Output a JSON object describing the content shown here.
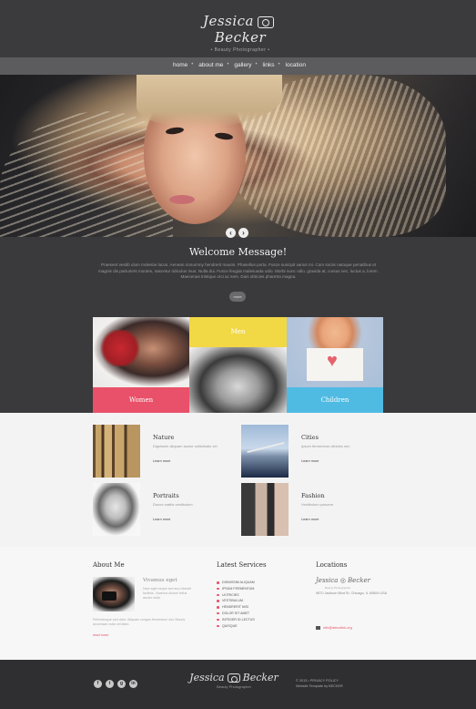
{
  "brand": {
    "name_left": "Jessica",
    "name_right": "Becker",
    "tagline": "Beauty Photographer"
  },
  "nav": {
    "items": [
      "home",
      "about me",
      "gallery",
      "links",
      "location"
    ]
  },
  "slider": {
    "prev_icon": "chevron-left-icon",
    "next_icon": "chevron-right-icon",
    "prev_glyph": "‹",
    "next_glyph": "›"
  },
  "welcome": {
    "title": "Welcome Message!",
    "text": "Praesent vestib ulum molestie lacus. Aenean nonummy hendrerit mauris. Phasellus porta. Fusce suscipit varius mi. Cum sociis natoque penatibus et magnis dis parturient montes, nascetur ridiculus mus. Nulla dui. Fusce feugiat malesuada odio. Morbi nunc odio, gravida at, cursus nec, luctus a, lorem. Maecenas tristique orci ac sem. Duis ultricies pharetra magna.",
    "more_label": "more"
  },
  "gallery": {
    "women": "Women",
    "men": "Men",
    "children": "Children"
  },
  "categories": [
    {
      "title": "Nature",
      "subtitle": "Dignissim aliquam auctor sollicitudin vel",
      "read_more": "Learn more"
    },
    {
      "title": "Cities",
      "subtitle": "Ipsum fermentum ultricies nec",
      "read_more": "Learn more"
    },
    {
      "title": "Portraits",
      "subtitle": "Donec mattis vestibulum",
      "read_more": "Learn more"
    },
    {
      "title": "Fashion",
      "subtitle": "Vestibulum posuere",
      "read_more": "Learn more"
    }
  ],
  "about": {
    "title": "About Me",
    "name": "Vivamus eget",
    "text1": "Nam eget neque sed arcu blandit facilisis. Vivamus dictum tellus auctor nulla.",
    "text2": "Pellentesque sed dolor. Aliquam congue fermentum nisl. Mauris accumsan nulla vel diam.",
    "read_more": "read more"
  },
  "services": {
    "title": "Latest Services",
    "items": [
      "Dignissim aliquam",
      "Ipsum fermentum",
      "Ultricies",
      "Vestibulum",
      "Hendrerit nisi",
      "Dolor sit amet",
      "Integer id lectus",
      "Quisque"
    ]
  },
  "locations": {
    "title": "Locations",
    "address": "9870 Jackson Blvd St. Chicago, IL 60604 USA",
    "email": "info@demolink.org"
  },
  "footer": {
    "socials": [
      "f",
      "t",
      "g",
      "in"
    ],
    "social_names": [
      "facebook-icon",
      "twitter-icon",
      "google-plus-icon",
      "linkedin-icon"
    ],
    "copyright": "© 2013 • PRIVACY POLICY",
    "copyright2": "Website Template by BECKER"
  }
}
